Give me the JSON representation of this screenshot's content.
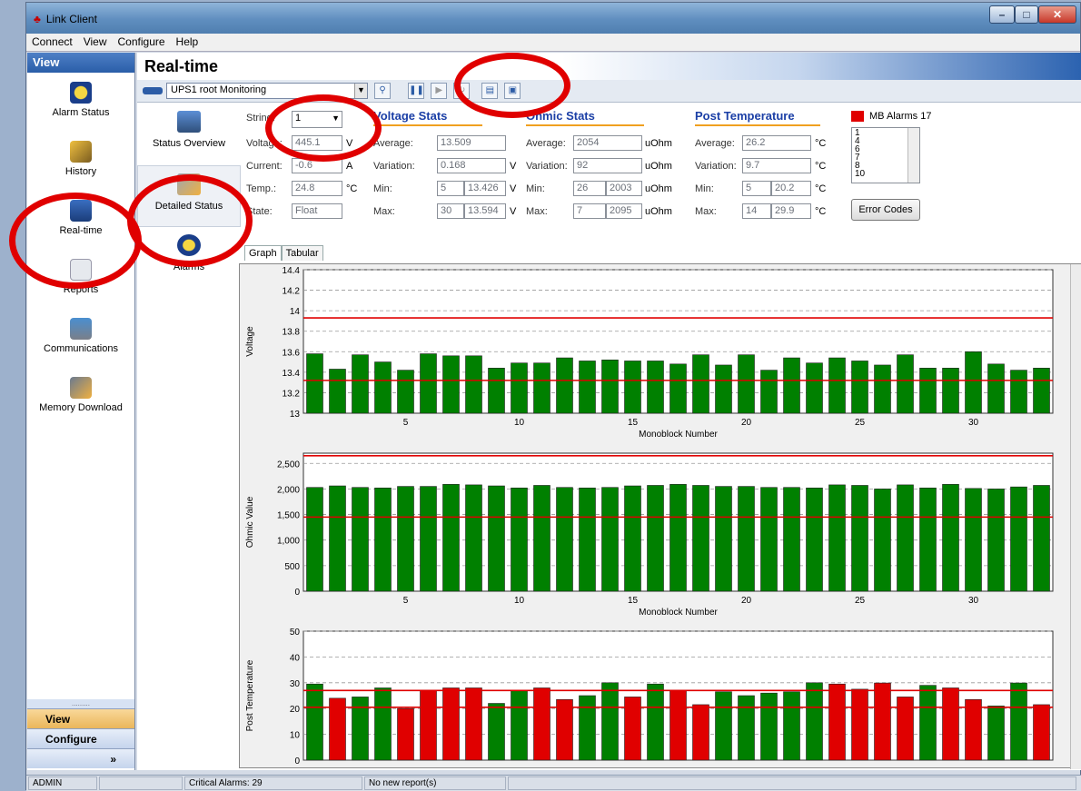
{
  "window": {
    "title": "Link Client",
    "min": "–",
    "max": "□",
    "close": "✕"
  },
  "menu": [
    "Connect",
    "View",
    "Configure",
    "Help"
  ],
  "nav": {
    "header": "View",
    "items": [
      "Alarm Status",
      "History",
      "Real-time",
      "Reports",
      "Communications",
      "Memory Download"
    ],
    "bottom": [
      "View",
      "Configure"
    ],
    "dots": "........."
  },
  "page": {
    "title": "Real-time",
    "device": "UPS1 root Monitoring"
  },
  "subnav": [
    "Status Overview",
    "Detailed Status",
    "Alarms"
  ],
  "string": {
    "label": "String:",
    "value": "1"
  },
  "general": {
    "voltage_label": "Voltage:",
    "voltage": "445.1",
    "voltage_unit": "V",
    "current_label": "Current:",
    "current": "-0.6",
    "current_unit": "A",
    "temp_label": "Temp.:",
    "temp": "24.8",
    "temp_unit": "°C",
    "state_label": "State:",
    "state": "Float"
  },
  "voltage_stats": {
    "title": "Voltage Stats",
    "avg_label": "Average:",
    "avg": "13.509",
    "var_label": "Variation:",
    "var": "0.168",
    "var_unit": "V",
    "min_label": "Min:",
    "min_n": "5",
    "min_v": "13.426",
    "min_unit": "V",
    "max_label": "Max:",
    "max_n": "30",
    "max_v": "13.594",
    "max_unit": "V"
  },
  "ohmic_stats": {
    "title": "Ohmic Stats",
    "avg_label": "Average:",
    "avg": "2054",
    "avg_unit": "uOhm",
    "var_label": "Variation:",
    "var": "92",
    "var_unit": "uOhm",
    "min_label": "Min:",
    "min_n": "26",
    "min_v": "2003",
    "min_unit": "uOhm",
    "max_label": "Max:",
    "max_n": "7",
    "max_v": "2095",
    "max_unit": "uOhm"
  },
  "temp_stats": {
    "title": "Post Temperature",
    "avg_label": "Average:",
    "avg": "26.2",
    "avg_unit": "°C",
    "var_label": "Variation:",
    "var": "9.7",
    "var_unit": "°C",
    "min_label": "Min:",
    "min_n": "5",
    "min_v": "20.2",
    "min_unit": "°C",
    "max_label": "Max:",
    "max_n": "14",
    "max_v": "29.9",
    "max_unit": "°C"
  },
  "alarms": {
    "title": "MB Alarms 17",
    "list": [
      "1",
      "4",
      "6",
      "7",
      "8",
      "10"
    ],
    "button": "Error Codes",
    "color": "#e00000"
  },
  "tabs": [
    "Graph",
    "Tabular"
  ],
  "status": {
    "user": "ADMIN",
    "critical": "Critical Alarms: 29",
    "reports": "No new report(s)"
  },
  "chart_data": [
    {
      "type": "bar",
      "ylabel": "Voltage",
      "xlabel": "Monoblock Number",
      "ylim": [
        13,
        14.4
      ],
      "yticks": [
        "13",
        "13.2",
        "13.4",
        "13.6",
        "13.8",
        "14",
        "14.2",
        "14.4"
      ],
      "xticks": [
        5,
        10,
        15,
        20,
        25,
        30
      ],
      "thresholds": [
        13.93,
        13.32
      ],
      "threshold_color": "#e00000",
      "colors": {
        "normal": "#008000",
        "alarm": "#e00000"
      },
      "values": [
        13.58,
        13.43,
        13.57,
        13.5,
        13.42,
        13.58,
        13.56,
        13.56,
        13.44,
        13.49,
        13.49,
        13.54,
        13.51,
        13.52,
        13.51,
        13.51,
        13.48,
        13.57,
        13.47,
        13.57,
        13.42,
        13.54,
        13.49,
        13.54,
        13.51,
        13.47,
        13.57,
        13.44,
        13.44,
        13.6,
        13.48,
        13.42,
        13.44
      ],
      "alarm": []
    },
    {
      "type": "bar",
      "ylabel": "Ohmic Value",
      "xlabel": "Monoblock Number",
      "ylim": [
        0,
        2700
      ],
      "yticks": [
        "0",
        "500",
        "1,000",
        "1,500",
        "2,000",
        "2,500"
      ],
      "xticks": [
        5,
        10,
        15,
        20,
        25,
        30
      ],
      "thresholds": [
        2650,
        1450
      ],
      "threshold_color": "#e00000",
      "colors": {
        "normal": "#008000",
        "alarm": "#e00000"
      },
      "values": [
        2030,
        2060,
        2030,
        2020,
        2050,
        2050,
        2090,
        2080,
        2060,
        2020,
        2070,
        2030,
        2020,
        2030,
        2060,
        2070,
        2090,
        2070,
        2050,
        2050,
        2030,
        2030,
        2020,
        2080,
        2070,
        2000,
        2080,
        2020,
        2090,
        2010,
        2000,
        2040,
        2070
      ],
      "alarm": []
    },
    {
      "type": "bar",
      "ylabel": "Post Temperature",
      "xlabel": "",
      "ylim": [
        0,
        50
      ],
      "yticks": [
        "0",
        "10",
        "20",
        "30",
        "40",
        "50"
      ],
      "xticks": [],
      "thresholds": [
        27,
        20.5
      ],
      "threshold_color": "#e00000",
      "colors": {
        "normal": "#008000",
        "alarm": "#e00000"
      },
      "values": [
        29.5,
        24,
        24.5,
        28,
        20,
        27,
        28,
        28,
        22,
        27,
        28,
        23.5,
        25,
        30,
        24.5,
        29.5,
        27,
        21.5,
        26.5,
        25,
        26,
        26.5,
        30,
        29.5,
        27.5,
        29.9,
        24.5,
        29,
        28,
        23.5,
        21,
        29.9,
        21.5
      ],
      "alarm": [
        1,
        4,
        5,
        6,
        7,
        10,
        11,
        14,
        16,
        17,
        23,
        24,
        25,
        26,
        28,
        29,
        32
      ]
    }
  ]
}
